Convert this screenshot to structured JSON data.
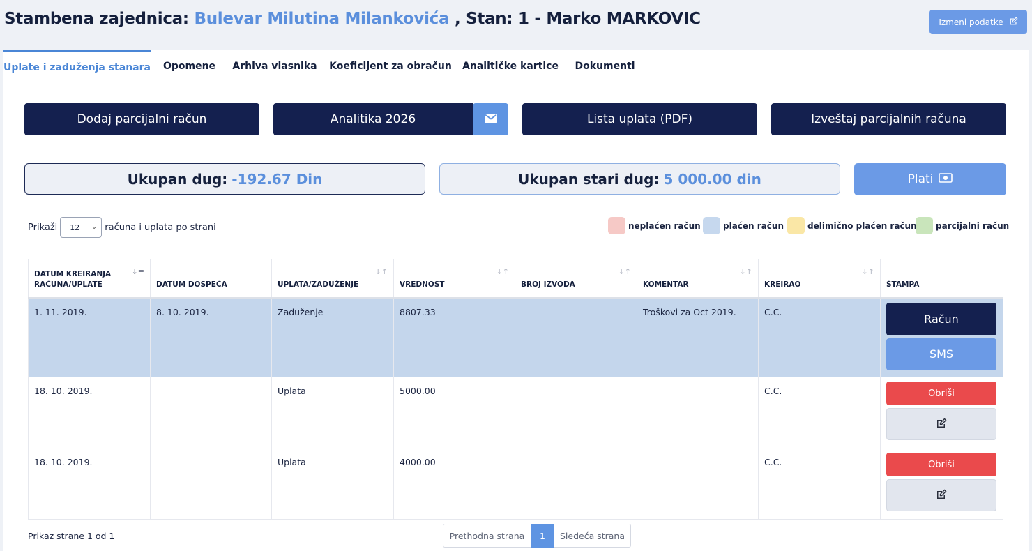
{
  "header": {
    "label": "Stambena zajednica:",
    "community": "Bulevar Milutina Milankovića",
    "apartment": ", Stan: 1 - Marko MARKOVIC",
    "edit_label": "Izmeni podatke"
  },
  "tabs": [
    {
      "label": "Uplate i zaduženja stanara",
      "active": true
    },
    {
      "label": "Opomene"
    },
    {
      "label": "Arhiva vlasnika"
    },
    {
      "label": "Koeficijent za obračun"
    },
    {
      "label": "Analitičke kartice"
    },
    {
      "label": "Dokumenti"
    }
  ],
  "actions": {
    "add_partial": "Dodaj parcijalni račun",
    "analytics": "Analitika 2026",
    "payments_pdf": "Lista uplata (PDF)",
    "partial_report": "Izveštaj parcijalnih računa"
  },
  "summary": {
    "debt_label": "Ukupan dug:",
    "debt_value": "-192.67 Din",
    "old_debt_label": "Ukupan stari dug:",
    "old_debt_value": "5 000.00 din",
    "pay_label": "Plati"
  },
  "page_size": {
    "prefix": "Prikaži",
    "value": "12",
    "suffix": "računa i uplata po strani"
  },
  "legend": [
    {
      "label": "neplaćen račun",
      "color": "#f6c9c6"
    },
    {
      "label": "plaćen račun",
      "color": "#c6d8ee"
    },
    {
      "label": "delimično plaćen račun",
      "color": "#fae7a6"
    },
    {
      "label": "parcijalni račun",
      "color": "#c9e5bb"
    }
  ],
  "table": {
    "columns": [
      {
        "line1": "DATUM KREIRANJA",
        "line2": "RAČUNA/UPLATE"
      },
      {
        "line1": "DATUM DOSPEĆA"
      },
      {
        "line1": "UPLATA/ZADUŽENJE"
      },
      {
        "line1": "VREDNOST"
      },
      {
        "line1": "BROJ IZVODA"
      },
      {
        "line1": "KOMENTAR"
      },
      {
        "line1": "KREIRAO"
      },
      {
        "line1": "ŠTAMPA"
      }
    ],
    "rows": [
      {
        "created": "1. 11. 2019.",
        "due": "8. 10. 2019.",
        "type": "Zaduženje",
        "amount": "8807.33",
        "statement": "",
        "comment": "Troškovi za Oct 2019.",
        "author": "C.C.",
        "btn1": "Račun",
        "btn2": "SMS"
      },
      {
        "created": "18. 10. 2019.",
        "due": "",
        "type": "Uplata",
        "amount": "5000.00",
        "statement": "",
        "comment": "",
        "author": "C.C.",
        "btn1": "Obriši"
      },
      {
        "created": "18. 10. 2019.",
        "due": "",
        "type": "Uplata",
        "amount": "4000.00",
        "statement": "",
        "comment": "",
        "author": "C.C.",
        "btn1": "Obriši"
      }
    ]
  },
  "pagination": {
    "info": "Prikaz strane 1 od 1",
    "prev": "Prethodna strana",
    "current": "1",
    "next": "Sledeća strana"
  }
}
